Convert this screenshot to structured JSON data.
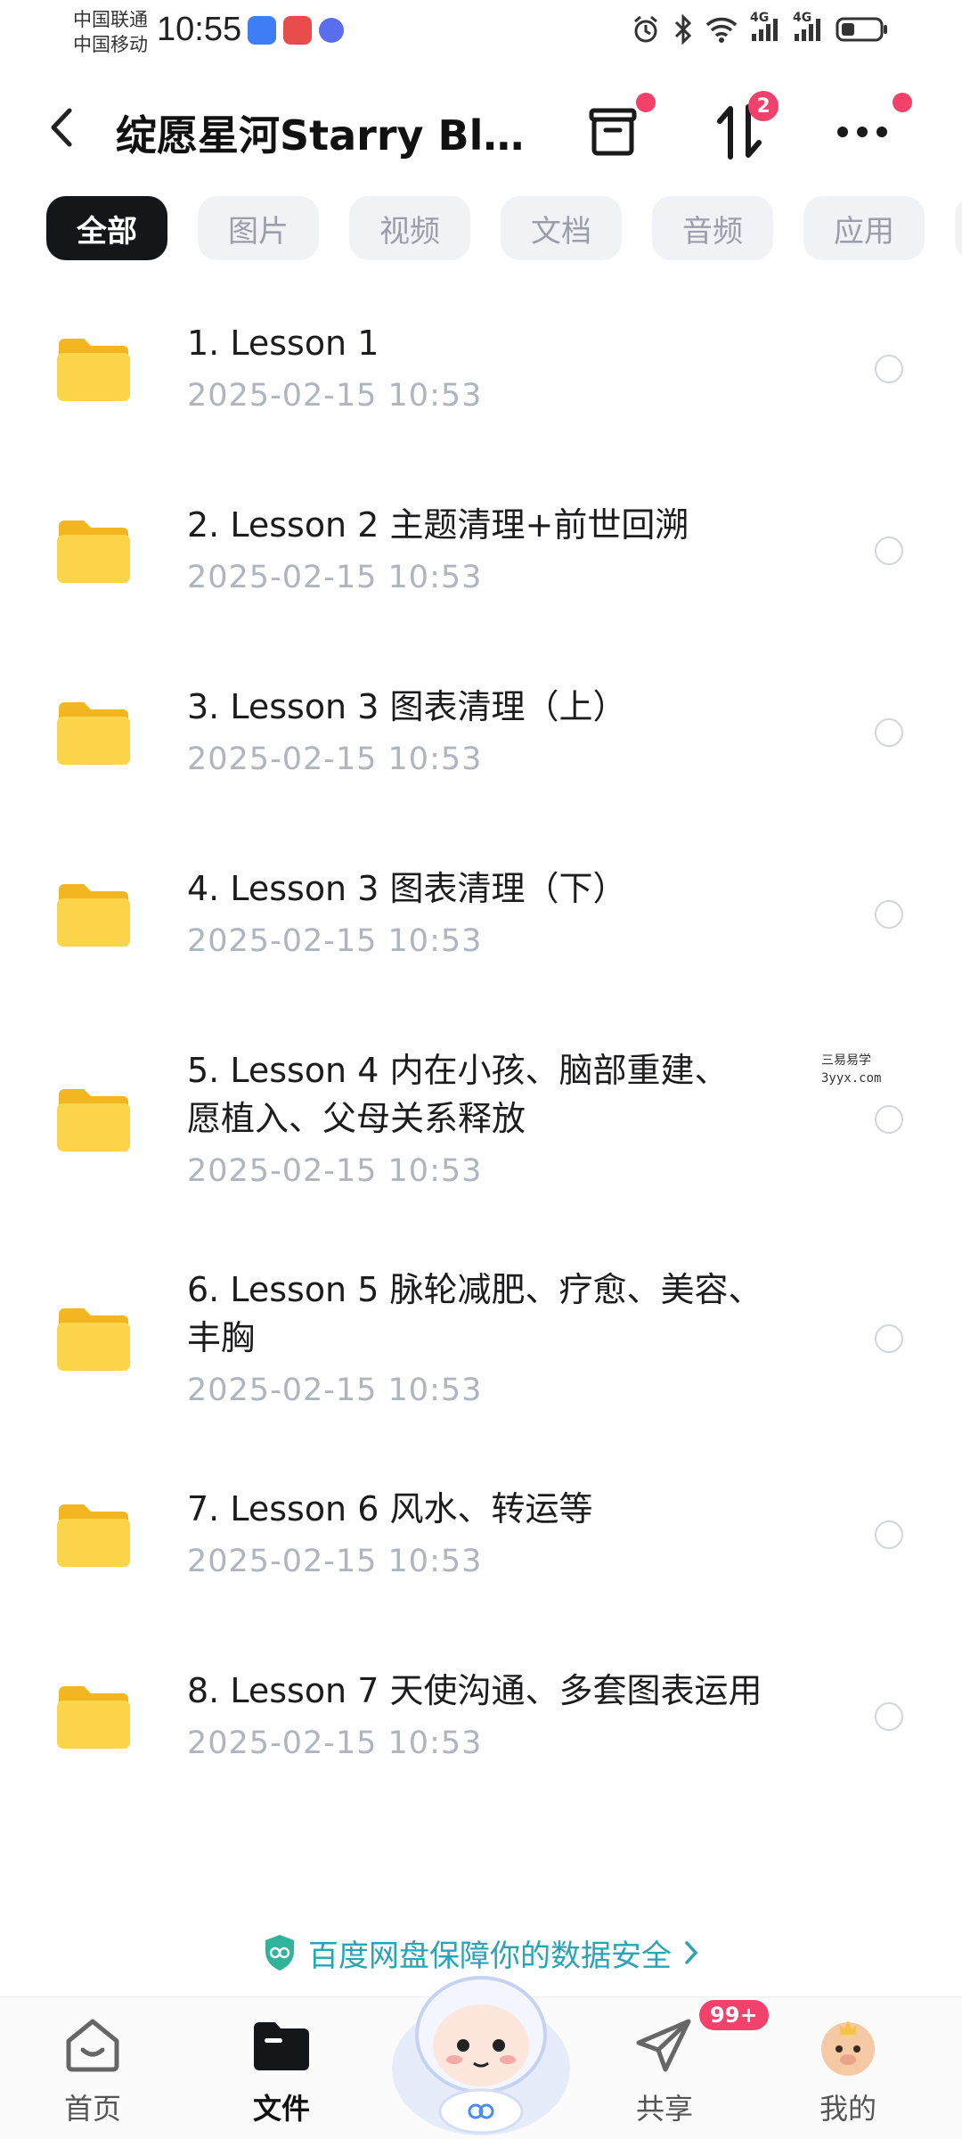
{
  "status_bar": {
    "carrier_1": "中国联通",
    "carrier_2": "中国移动",
    "time": "10:55",
    "net_1": "4G",
    "net_2": "4G"
  },
  "header": {
    "title": "绽愿星河Starry Bl...",
    "sort_badge": "2"
  },
  "tabs": [
    {
      "label": "全部",
      "active": true
    },
    {
      "label": "图片",
      "active": false
    },
    {
      "label": "视频",
      "active": false
    },
    {
      "label": "文档",
      "active": false
    },
    {
      "label": "音频",
      "active": false
    },
    {
      "label": "应用",
      "active": false
    }
  ],
  "files": [
    {
      "name": "1. Lesson 1",
      "date": "2025-02-15  10:53"
    },
    {
      "name": "2. Lesson 2 主题清理+前世回溯",
      "date": "2025-02-15  10:53"
    },
    {
      "name": "3. Lesson 3 图表清理（上）",
      "date": "2025-02-15  10:53"
    },
    {
      "name": "4. Lesson 3 图表清理（下）",
      "date": "2025-02-15  10:53"
    },
    {
      "name": "5. Lesson 4 内在小孩、脑部重建、",
      "name_line2": "愿植入、父母关系释放",
      "date": "2025-02-15  10:53"
    },
    {
      "name": "6. Lesson 5 脉轮减肥、疗愈、美容、",
      "name_line2": "丰胸",
      "date": "2025-02-15  10:53"
    },
    {
      "name": "7. Lesson 6 风水、转运等",
      "date": "2025-02-15  10:53"
    },
    {
      "name": "8. Lesson 7 天使沟通、多套图表运用",
      "date": "2025-02-15  10:53"
    }
  ],
  "watermark": {
    "line1": "三易易学",
    "line2": "3yyx.com"
  },
  "safety_banner": "百度网盘保障你的数据安全",
  "bottom_nav": {
    "home": "首页",
    "files": "文件",
    "share": "共享",
    "share_badge": "99+",
    "mine": "我的"
  },
  "colors": {
    "accent_dark": "#15161a",
    "badge_red": "#f2416b",
    "folder_yellow": "#f9c93c",
    "safety_teal": "#2aa3b5"
  }
}
